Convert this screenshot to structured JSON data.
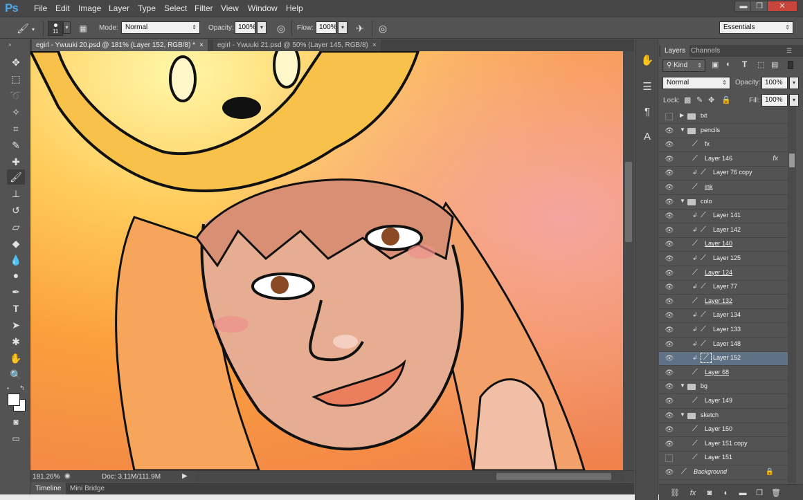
{
  "app": {
    "logo": "Ps"
  },
  "menu": [
    "File",
    "Edit",
    "Image",
    "Layer",
    "Type",
    "Select",
    "Filter",
    "View",
    "Window",
    "Help"
  ],
  "window_controls": {
    "minimize": "▬",
    "restore": "❐",
    "close": "✕"
  },
  "options": {
    "brush_size": "11",
    "mode_label": "Mode:",
    "mode_value": "Normal",
    "opacity_label": "Opacity:",
    "opacity_value": "100%",
    "flow_label": "Flow:",
    "flow_value": "100%",
    "workspace": "Essentials"
  },
  "documents": [
    {
      "title": "egirl - Ywuuki 20.psd @ 181% (Layer 152, RGB/8) *",
      "close": "×"
    },
    {
      "title": "egirl - Ywuuki 21.psd @ 50% (Layer 145, RGB/8)",
      "close": "×"
    }
  ],
  "status": {
    "zoom": "181.26%",
    "doc_size": "Doc: 3.11M/111.9M"
  },
  "bottom_tabs": [
    "Timeline",
    "Mini Bridge"
  ],
  "panel": {
    "tabs": [
      "Layers",
      "Channels"
    ],
    "filter_kind": "Kind",
    "blend_mode": "Normal",
    "opacity_label": "Opacity:",
    "opacity_value": "100%",
    "lock_label": "Lock:",
    "fill_label": "Fill:",
    "fill_value": "100%"
  },
  "layers": [
    {
      "name": "txt",
      "type": "group",
      "collapsed": true,
      "visible": false,
      "indent": 0
    },
    {
      "name": "pencils",
      "type": "group",
      "collapsed": false,
      "visible": true,
      "indent": 0
    },
    {
      "name": "fx",
      "type": "layer",
      "visible": true,
      "indent": 1
    },
    {
      "name": "Layer 146",
      "type": "layer",
      "visible": true,
      "indent": 1,
      "fx": "fx"
    },
    {
      "name": "Layer 76 copy",
      "type": "layer",
      "visible": true,
      "indent": 1,
      "clipped": true
    },
    {
      "name": "ink",
      "type": "layer",
      "visible": true,
      "indent": 1,
      "underline": true
    },
    {
      "name": "colo",
      "type": "group",
      "collapsed": false,
      "visible": true,
      "indent": 0
    },
    {
      "name": "Layer 141",
      "type": "layer",
      "visible": true,
      "indent": 1,
      "clipped": true
    },
    {
      "name": "Layer 142",
      "type": "layer",
      "visible": true,
      "indent": 1,
      "clipped": true
    },
    {
      "name": "Layer 140",
      "type": "layer",
      "visible": true,
      "indent": 1,
      "underline": true
    },
    {
      "name": "Layer 125",
      "type": "layer",
      "visible": true,
      "indent": 1,
      "clipped": true
    },
    {
      "name": "Layer 124",
      "type": "layer",
      "visible": true,
      "indent": 1,
      "underline": true
    },
    {
      "name": "Layer 77",
      "type": "layer",
      "visible": true,
      "indent": 1,
      "clipped": true
    },
    {
      "name": "Layer 132",
      "type": "layer",
      "visible": true,
      "indent": 1,
      "underline": true
    },
    {
      "name": "Layer 134",
      "type": "layer",
      "visible": true,
      "indent": 1,
      "clipped": true
    },
    {
      "name": "Layer 133",
      "type": "layer",
      "visible": true,
      "indent": 1,
      "clipped": true
    },
    {
      "name": "Layer 148",
      "type": "layer",
      "visible": true,
      "indent": 1,
      "clipped": true
    },
    {
      "name": "Layer 152",
      "type": "layer",
      "visible": true,
      "indent": 1,
      "clipped": true,
      "selected": true
    },
    {
      "name": "Layer 68",
      "type": "layer",
      "visible": true,
      "indent": 1,
      "underline": true
    },
    {
      "name": "bg",
      "type": "group",
      "collapsed": false,
      "visible": true,
      "indent": 0
    },
    {
      "name": "Layer 149",
      "type": "layer",
      "visible": true,
      "indent": 1
    },
    {
      "name": "sketch",
      "type": "group",
      "collapsed": false,
      "visible": true,
      "indent": 0
    },
    {
      "name": "Layer 150",
      "type": "layer",
      "visible": true,
      "indent": 1
    },
    {
      "name": "Layer 151 copy",
      "type": "layer",
      "visible": true,
      "indent": 1
    },
    {
      "name": "Layer 151",
      "type": "layer",
      "visible": false,
      "indent": 1
    },
    {
      "name": "Background",
      "type": "layer",
      "visible": true,
      "indent": 0,
      "italic": true,
      "locked": true
    }
  ],
  "colors": {
    "accent": "#4ea6e8",
    "selected_layer": "#5f7184",
    "panel_bg": "#535353"
  }
}
